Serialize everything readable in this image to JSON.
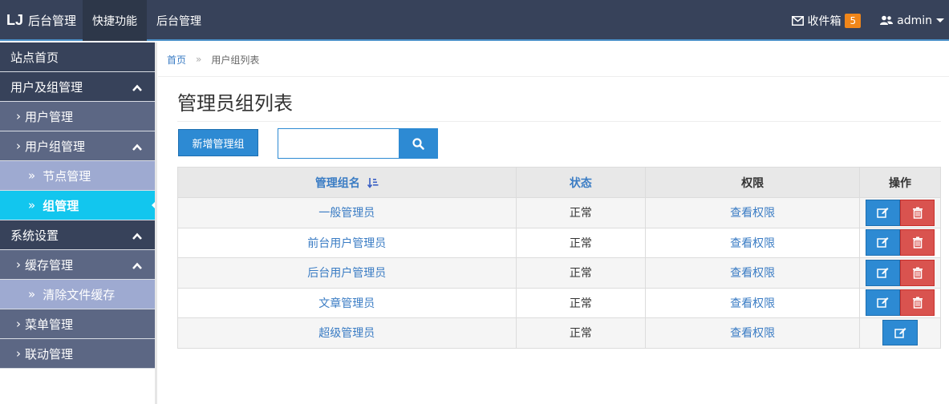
{
  "topbar": {
    "brand_logo": "LJ",
    "brand_text": "后台管理",
    "nav": [
      "快捷功能",
      "后台管理"
    ],
    "inbox_label": "收件箱",
    "inbox_count": "5",
    "user_name": "admin",
    "colors": {
      "bar": "#37425a",
      "badge": "#f0861a"
    }
  },
  "sidebar": {
    "home": "站点首页",
    "group_users": "用户及组管理",
    "user_mgmt": "用户管理",
    "group_mgmt": "用户组管理",
    "node_mgmt": "节点管理",
    "group_manage": "组管理",
    "system": "系统设置",
    "cache_mgmt": "缓存管理",
    "clear_cache": "清除文件缓存",
    "menu_mgmt": "菜单管理",
    "linkage_mgmt": "联动管理",
    "arrow_sub": "›",
    "arrow_leaf": "»"
  },
  "breadcrumb": {
    "home": "首页",
    "sep": "»",
    "current": "用户组列表"
  },
  "page": {
    "title": "管理员组列表",
    "add_button": "新增管理组",
    "search_placeholder": ""
  },
  "table": {
    "headers": {
      "name": "管理组名",
      "status": "状态",
      "perm": "权限",
      "ops": "操作"
    },
    "rows": [
      {
        "name": "一般管理员",
        "status": "正常",
        "perm": "查看权限",
        "deletable": true
      },
      {
        "name": "前台用户管理员",
        "status": "正常",
        "perm": "查看权限",
        "deletable": true
      },
      {
        "name": "后台用户管理员",
        "status": "正常",
        "perm": "查看权限",
        "deletable": true
      },
      {
        "name": "文章管理员",
        "status": "正常",
        "perm": "查看权限",
        "deletable": true
      },
      {
        "name": "超级管理员",
        "status": "正常",
        "perm": "查看权限",
        "deletable": false
      }
    ]
  },
  "icons": [
    "envelope-icon",
    "users-icon",
    "chevron-up-icon",
    "search-icon",
    "sort-icon",
    "edit-icon",
    "trash-icon"
  ]
}
